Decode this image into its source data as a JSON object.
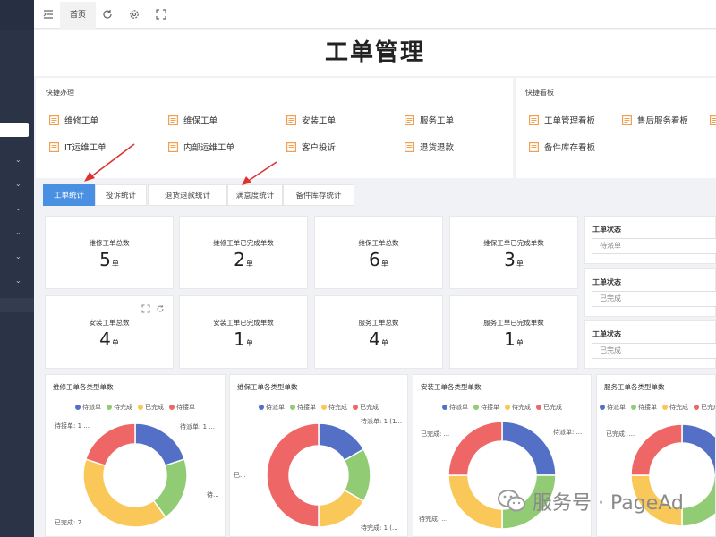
{
  "topbar": {
    "home_tab": "首页",
    "icons": [
      "menu-fold-icon",
      "refresh-icon",
      "settings-icon",
      "fullscreen-icon"
    ]
  },
  "page_title": "工单管理",
  "quick_actions": {
    "title": "快捷办理",
    "items": [
      "维修工单",
      "维保工单",
      "安装工单",
      "服务工单",
      "IT运维工单",
      "内部运维工单",
      "客户投诉",
      "退货退款"
    ]
  },
  "quick_boards": {
    "title": "快捷看板",
    "items": [
      "工单管理看板",
      "售后服务看板",
      "备件库存看板"
    ]
  },
  "tabs": [
    {
      "label": "工单统计",
      "active": true
    },
    {
      "label": "投诉统计",
      "active": false
    },
    {
      "label": "退货退款统计",
      "active": false
    },
    {
      "label": "满意度统计",
      "active": false
    },
    {
      "label": "备件库存统计",
      "active": false
    }
  ],
  "stats": [
    {
      "label": "维修工单总数",
      "value": "5",
      "unit": "单"
    },
    {
      "label": "维修工单已完成单数",
      "value": "2",
      "unit": "单"
    },
    {
      "label": "维保工单总数",
      "value": "6",
      "unit": "单"
    },
    {
      "label": "维保工单已完成单数",
      "value": "3",
      "unit": "单"
    },
    {
      "label": "安装工单总数",
      "value": "4",
      "unit": "单"
    },
    {
      "label": "安装工单已完成单数",
      "value": "1",
      "unit": "单"
    },
    {
      "label": "服务工单总数",
      "value": "4",
      "unit": "单"
    },
    {
      "label": "服务工单已完成单数",
      "value": "1",
      "unit": "单"
    }
  ],
  "status_filters": [
    {
      "title": "工单状态",
      "value": "待派单"
    },
    {
      "title": "工单状态",
      "value": "已完成"
    },
    {
      "title": "工单状态",
      "value": "已完成"
    }
  ],
  "colors": {
    "blue": "#5470c6",
    "green": "#91cc75",
    "yellow": "#fac858",
    "red": "#ee6666",
    "tab_active": "#4a90e2",
    "quick_icon": "#f0a050",
    "sidebar": "#2b3447"
  },
  "chart_data": [
    {
      "type": "pie",
      "title": "维修工单各类型单数",
      "legend": [
        "待派单",
        "待完成",
        "已完成",
        "待接单"
      ],
      "values": [
        1,
        1,
        2,
        1
      ],
      "colors": [
        "#5470c6",
        "#91cc75",
        "#fac858",
        "#ee6666"
      ],
      "labels": [
        "待派单: 1 ...",
        "待...",
        "已完成: 2 ...",
        "待接单: 1 ..."
      ]
    },
    {
      "type": "pie",
      "title": "维保工单各类型单数",
      "legend": [
        "待派单",
        "待接单",
        "待完成",
        "已完成"
      ],
      "values": [
        1,
        1,
        1,
        3
      ],
      "colors": [
        "#5470c6",
        "#91cc75",
        "#fac858",
        "#ee6666"
      ],
      "labels": [
        "待派单: 1 (1...",
        "",
        "待完成: 1 (...",
        "已..."
      ]
    },
    {
      "type": "pie",
      "title": "安装工单各类型单数",
      "legend": [
        "待派单",
        "待接单",
        "待完成",
        "已完成"
      ],
      "values": [
        1,
        1,
        1,
        1
      ],
      "colors": [
        "#5470c6",
        "#91cc75",
        "#fac858",
        "#ee6666"
      ],
      "labels": [
        "待派单: ...",
        "",
        "待完成: ...",
        "已完成: ..."
      ]
    },
    {
      "type": "pie",
      "title": "服务工单各类型单数",
      "legend": [
        "待派单",
        "待接单",
        "待完成",
        "已完成"
      ],
      "values": [
        1,
        1,
        1,
        1
      ],
      "colors": [
        "#5470c6",
        "#91cc75",
        "#fac858",
        "#ee6666"
      ],
      "labels": [
        "",
        "",
        "",
        "已完成: ..."
      ]
    }
  ],
  "watermark": "服务号 · PageAd"
}
